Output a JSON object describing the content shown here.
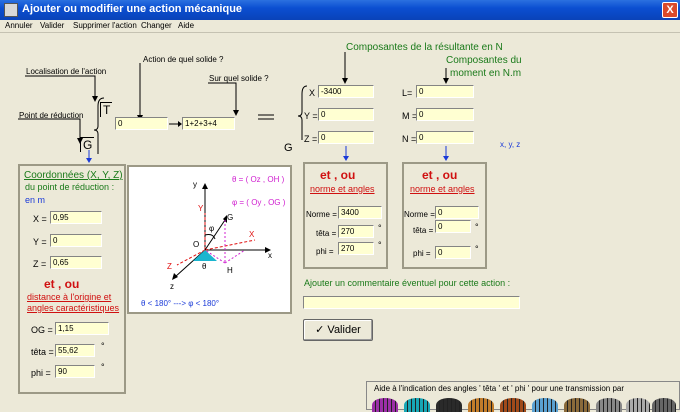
{
  "window": {
    "title": "Ajouter ou modifier une action mécanique",
    "close_glyph": "X"
  },
  "menu": [
    "Annuler",
    "Valider",
    "Supprimer l'action",
    "Changer",
    "Aide"
  ],
  "labels": {
    "localisation": "Localisation de l'action",
    "quel_solide": "Action de quel solide ?",
    "sur_quel_solide": "Sur quel solide ?",
    "point_reduction": "Point de réduction",
    "composantes_resultante": "Composantes de la résultante en N",
    "composantes_moment_1": "Composantes du",
    "composantes_moment_2": "moment en N.m"
  },
  "torseur": {
    "T": "T",
    "G": "G",
    "solide_action": "0",
    "solide_sur": "1+2+3+4",
    "equals": "="
  },
  "resultante": {
    "point": "G",
    "X_label": "X =",
    "X": "-3400",
    "Y_label": "Y =",
    "Y": "0",
    "Z_label": "Z =",
    "Z": "0"
  },
  "moment": {
    "L_label": "L=",
    "L": "0",
    "M_label": "M =",
    "M": "0",
    "N_label": "N =",
    "N": "0",
    "vectors": "x, y, z"
  },
  "coords_panel": {
    "title": "Coordonnées (X, Y, Z)",
    "subtitle": "du point de réduction :",
    "unit": "en m",
    "X_label": "X =",
    "X": "0,95",
    "Y_label": "Y =",
    "Y": "0",
    "Z_label": "Z =",
    "Z": "0,65",
    "et_ou": "et , ou",
    "distance_1": "distance à l'origine et",
    "distance_2": "angles caractéristiques",
    "OG_label": "OG =",
    "OG": "1,15",
    "teta_label": "têta =",
    "teta": "55,62",
    "phi_label": "phi =",
    "phi": "90",
    "deg": "°"
  },
  "diagram": {
    "theta_def": "θ = ( Oz , OH )",
    "phi_def": "φ = ( Oy , OG )",
    "axis_y": "y",
    "axis_x": "x",
    "axis_z": "z",
    "axis_Y": "Y",
    "axis_X": "X",
    "axis_Z": "Z",
    "pt_O": "O",
    "pt_G": "G",
    "pt_H": "H",
    "phi_sym": "φ",
    "theta_sym": "θ",
    "range": "θ < 180°  --->  φ < 180°"
  },
  "res_panel": {
    "et_ou": "et , ou",
    "norme_angles": "norme et angles",
    "norme_label": "Norme =",
    "norme": "3400",
    "teta_label": "têta =",
    "teta": "270",
    "phi_label": "phi =",
    "phi": "270",
    "deg": "°"
  },
  "mom_panel": {
    "et_ou": "et , ou",
    "norme_angles": "norme et angles",
    "norme_label": "Norme =",
    "norme": "0",
    "teta_label": "têta =",
    "teta": "0",
    "phi_label": "phi =",
    "phi": "0",
    "deg": "°"
  },
  "comment": {
    "label": "Ajouter un commentaire éventuel pour cette action :",
    "value": ""
  },
  "valider_button": {
    "check": "✓",
    "label": "Valider"
  },
  "aide_angles": "Aide à l'indication des angles ' têta ' et ' phi ' pour une transmission par",
  "gear_colors": [
    "#9c2fa8",
    "#17a7b5",
    "#2a2a2a",
    "#c27c2a",
    "#a04a1a",
    "#5aa0d0",
    "#8a6a3a",
    "#888888",
    "#aaaaaa",
    "#666666"
  ]
}
